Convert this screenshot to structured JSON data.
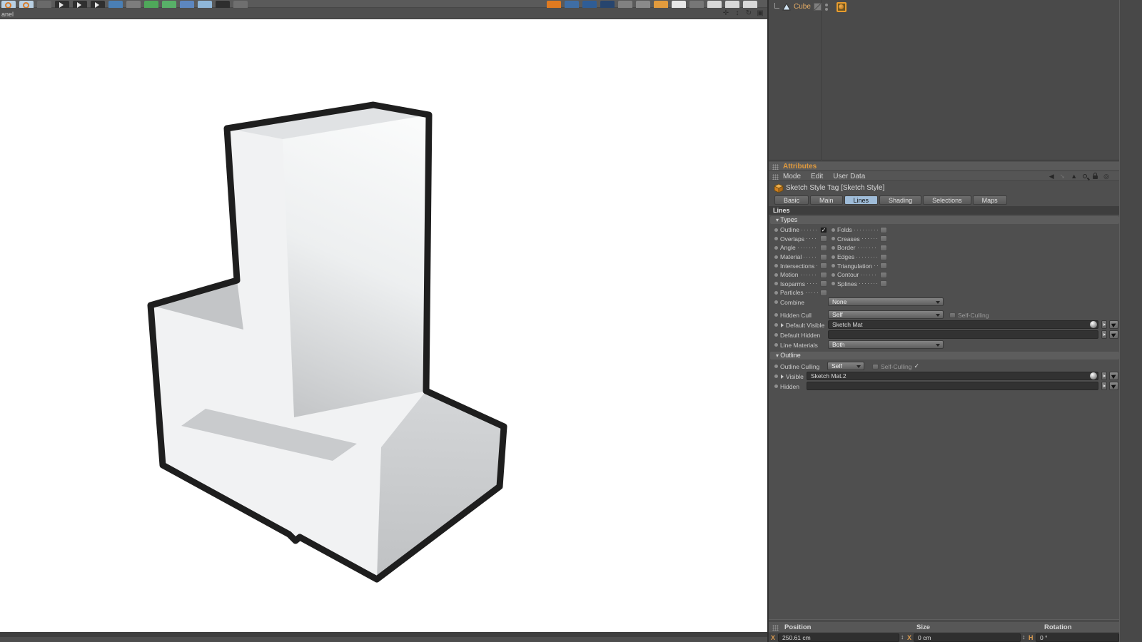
{
  "toolbar": {
    "left_icons": [
      {
        "name": "undo-icon",
        "color": "#b9d0e3",
        "kind": "ring"
      },
      {
        "name": "redo-icon",
        "color": "#b9d0e3",
        "kind": "ring"
      },
      {
        "name": "branch-arrow-icon",
        "color": "#6a6a6a",
        "kind": "plain"
      },
      {
        "name": "play-backward-icon",
        "color": "#2f2f2f",
        "kind": "play"
      },
      {
        "name": "play-icon",
        "color": "#2f2f2f",
        "kind": "play"
      },
      {
        "name": "play-forward-icon",
        "color": "#2f2f2f",
        "kind": "play"
      },
      {
        "name": "cube-tool-icon",
        "color": "#4a7fb5",
        "kind": "plain"
      },
      {
        "name": "pen-tool-icon",
        "color": "#7d7d7d",
        "kind": "plain"
      },
      {
        "name": "magnet-tool-icon",
        "color": "#4fa85a",
        "kind": "plain"
      },
      {
        "name": "scale-tool-icon",
        "color": "#58b068",
        "kind": "plain"
      },
      {
        "name": "polygon-tool-icon",
        "color": "#5d87c0",
        "kind": "plain"
      },
      {
        "name": "plane-tool-icon",
        "color": "#8fb6d8",
        "kind": "plain"
      },
      {
        "name": "camera-tool-icon",
        "color": "#2e2e2e",
        "kind": "plain"
      },
      {
        "name": "display-tool-icon",
        "color": "#6f6f6f",
        "kind": "plain"
      }
    ],
    "right_icons": [
      {
        "name": "lamp-icon",
        "color": "#e07a20",
        "kind": "plain"
      },
      {
        "name": "material-editor-icon",
        "color": "#3f6ea5",
        "kind": "plain"
      },
      {
        "name": "coordinates-manager-icon",
        "color": "#2f5d96",
        "kind": "plain"
      },
      {
        "name": "content-browser-icon",
        "color": "#27456e",
        "kind": "plain"
      },
      {
        "name": "circle-icon",
        "color": "#818181",
        "kind": "plain"
      },
      {
        "name": "minus-icon",
        "color": "#8a8a8a",
        "kind": "plain"
      },
      {
        "name": "footprints-icon",
        "color": "#e29b3d",
        "kind": "plain"
      },
      {
        "name": "render-frame-icon",
        "color": "#e8e8e8",
        "kind": "plain"
      },
      {
        "name": "close-x-icon",
        "color": "#777777",
        "kind": "plain"
      },
      {
        "name": "layout-list-1-icon",
        "color": "#d8d8d8",
        "kind": "plain"
      },
      {
        "name": "layout-list-2-icon",
        "color": "#d8d8d8",
        "kind": "plain"
      },
      {
        "name": "layout-list-3-icon",
        "color": "#d8d8d8",
        "kind": "plain"
      }
    ]
  },
  "viewport": {
    "menu_label": "anel",
    "nav_icons": [
      {
        "name": "pan-icon",
        "glyph": "✛"
      },
      {
        "name": "dolly-icon",
        "glyph": "↕"
      },
      {
        "name": "orbit-icon",
        "glyph": "↻"
      },
      {
        "name": "toggle-view-icon",
        "glyph": "▣"
      }
    ]
  },
  "object_manager": {
    "object_name": "Cube",
    "tag_name": "sketch-style-tag"
  },
  "attributes": {
    "panel_title": "Attributes",
    "menu_items": [
      "Mode",
      "Edit",
      "User Data"
    ],
    "tag_title": "Sketch Style Tag [Sketch Style]",
    "tabs": [
      "Basic",
      "Main",
      "Lines",
      "Shading",
      "Selections",
      "Maps"
    ],
    "active_tab": "Lines",
    "section_title": "Lines",
    "types_header": "Types",
    "types_left": [
      {
        "label": "Outline",
        "checked": true
      },
      {
        "label": "Overlaps",
        "checked": false
      },
      {
        "label": "Angle",
        "checked": false
      },
      {
        "label": "Material",
        "checked": false
      },
      {
        "label": "Intersections",
        "checked": false
      },
      {
        "label": "Motion",
        "checked": false
      },
      {
        "label": "Isoparms",
        "checked": false
      },
      {
        "label": "Particles",
        "checked": false
      }
    ],
    "types_right": [
      {
        "label": "Folds",
        "checked": false
      },
      {
        "label": "Creases",
        "checked": false
      },
      {
        "label": "Border",
        "checked": false
      },
      {
        "label": "Edges",
        "checked": false
      },
      {
        "label": "Triangulation",
        "checked": false
      },
      {
        "label": "Contour",
        "checked": false
      },
      {
        "label": "Splines",
        "checked": false
      }
    ],
    "combine": {
      "label": "Combine",
      "value": "None"
    },
    "hidden_cull": {
      "label": "Hidden Cull",
      "value": "Self",
      "self_culling_label": "Self-Culling",
      "self_culling_checked": false
    },
    "default_visible": {
      "label": "Default Visible",
      "value": "Sketch Mat"
    },
    "default_hidden": {
      "label": "Default Hidden",
      "value": ""
    },
    "line_materials": {
      "label": "Line Materials",
      "value": "Both"
    },
    "outline_header": "Outline",
    "outline_culling": {
      "label": "Outline Culling",
      "value": "Self",
      "self_culling_label": "Self-Culling",
      "self_culling_checked": true
    },
    "visible": {
      "label": "Visible",
      "value": "Sketch Mat.2"
    },
    "hidden": {
      "label": "Hidden",
      "value": ""
    }
  },
  "coordinates": {
    "headers": [
      "Position",
      "Size",
      "Rotation"
    ],
    "position_x_label": "X",
    "position_x_value": "250.61 cm",
    "size_x_label": "X",
    "size_x_value": "0 cm",
    "rotation_h_label": "H",
    "rotation_h_value": "0 °"
  },
  "colors": {
    "accent_orange": "#e09a3e",
    "active_tab_blue": "#9fbcd8",
    "outline_black": "#1e1e1e",
    "viewport_bg": "#ffffff"
  }
}
